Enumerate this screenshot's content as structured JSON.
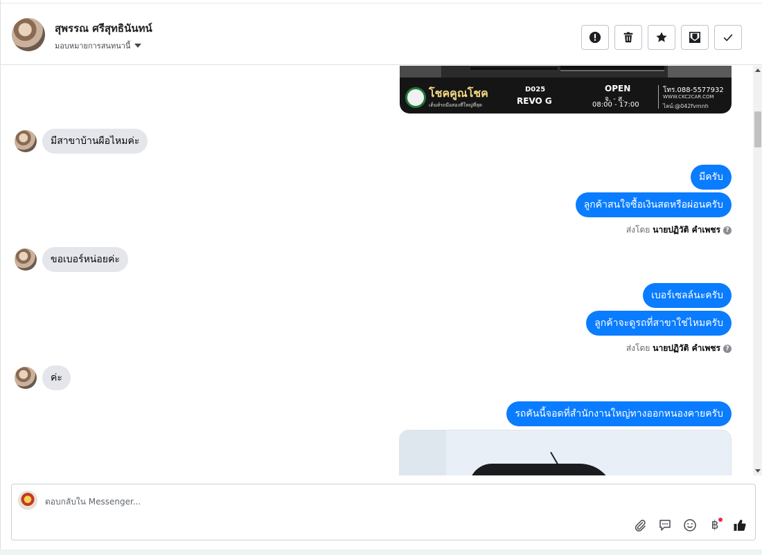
{
  "header": {
    "contact_name": "สุพรรณ ศรีสุทธินันทน์",
    "assign_label": "มอบหมายการสนทนานี้",
    "actions": [
      {
        "name": "spam-button",
        "icon": "exclamation-icon"
      },
      {
        "name": "delete-button",
        "icon": "trash-icon"
      },
      {
        "name": "star-button",
        "icon": "star-icon"
      },
      {
        "name": "mark-unread-button",
        "icon": "envelope-icon"
      },
      {
        "name": "done-button",
        "icon": "checkmark-icon"
      }
    ]
  },
  "banner": {
    "brand": "โชคคูณโชค",
    "brand_sub": "เต็นท์รถมือสองที่ใหญ่ที่สุด",
    "code": "D025",
    "model": "REVO G",
    "open": "OPEN",
    "days": "จ. - ส.",
    "hours": "08:00 - 17:00",
    "phone": "โทร.088-5577932",
    "website": "WWW.CKC2CAR.COM",
    "line": "ไลน์:@042fvmnh"
  },
  "messages": {
    "in1": "มีสาขาบ้านผือไหมค่ะ",
    "out1": "มีครับ",
    "out2": "ลูกค้าสนใจซื้อเงินสดหรือผ่อนครับ",
    "sent_prefix": "ส่งโดย",
    "sender": "นายปฏิวัติ คำเพชร",
    "in2": "ขอเบอร์หน่อยค่ะ",
    "out3": "เบอร์เซลล์นะครับ",
    "out4": "ลูกค้าจะดูรถที่สาขาใช่ไหมครับ",
    "in3": "ค่ะ",
    "out5": "รถคันนี้จอดที่สำนักงานใหญ่ทางออกหนองคายครับ"
  },
  "composer": {
    "placeholder": "ตอบกลับใน Messenger...",
    "baht_symbol": "฿"
  },
  "colors": {
    "outgoing_bubble": "#0a7cff",
    "incoming_bubble": "#e4e6eb",
    "brand_gold": "#f5d983"
  }
}
